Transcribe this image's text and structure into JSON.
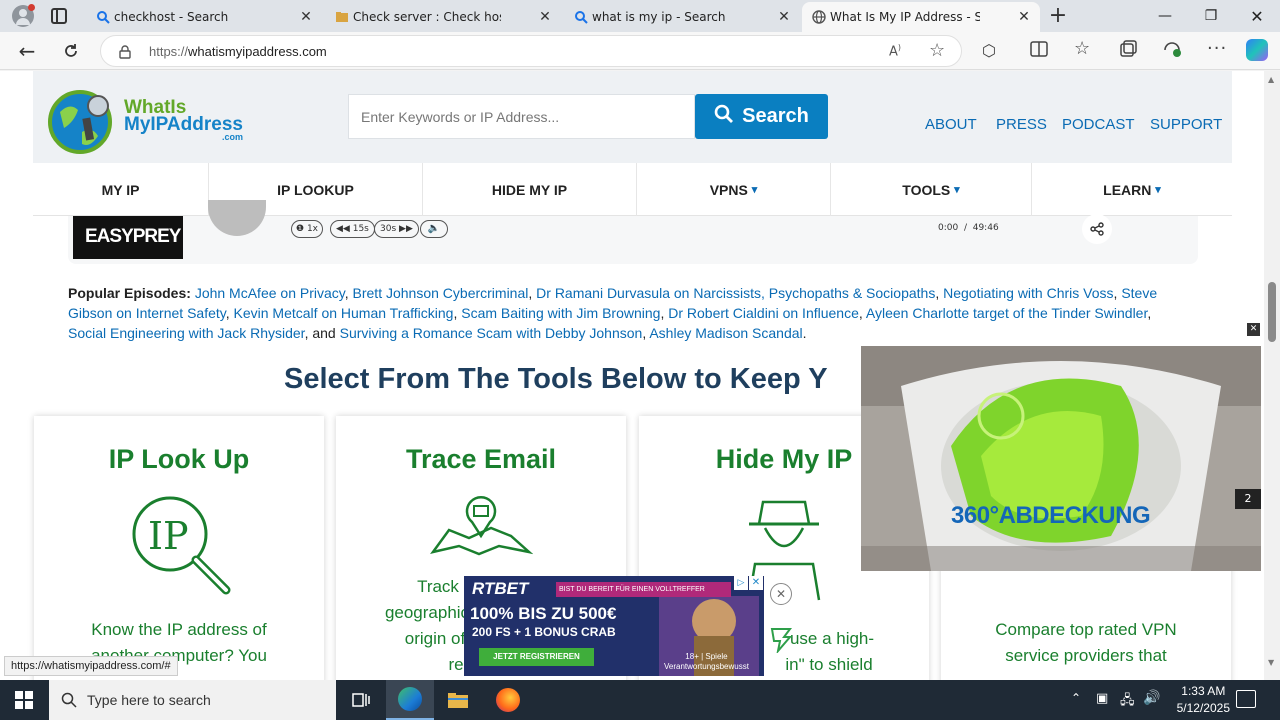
{
  "browser": {
    "tabs": [
      {
        "title": "checkhost - Search",
        "active": false
      },
      {
        "title": "Check server : Check host - online",
        "active": false
      },
      {
        "title": "what is my ip - Search",
        "active": false
      },
      {
        "title": "What Is My IP Address - See Your",
        "active": true
      }
    ],
    "url_prefix": "https://",
    "url_host": "whatismyipaddress.com",
    "status_url": "https://whatismyipaddress.com/#"
  },
  "site": {
    "logo_line1": "WhatIs",
    "logo_line2": "MyIPAddress",
    "logo_line3": ".com",
    "search_placeholder": "Enter Keywords or IP Address...",
    "search_button": "Search",
    "top_links": [
      "ABOUT",
      "PRESS",
      "PODCAST",
      "SUPPORT"
    ],
    "nav": [
      {
        "label": "MY IP",
        "arrow": ""
      },
      {
        "label": "IP LOOKUP",
        "arrow": ""
      },
      {
        "label": "HIDE MY IP",
        "arrow": ""
      },
      {
        "label": "VPNS",
        "arrow": "▾"
      },
      {
        "label": "TOOLS",
        "arrow": "▾"
      },
      {
        "label": "LEARN",
        "arrow": "▾"
      }
    ],
    "player": {
      "cover_text": "EASYPREY",
      "speed": "1x",
      "back": "15s",
      "fwd": "30s",
      "time_current": "0:00",
      "time_sep": "/",
      "time_total": "49:46"
    },
    "popular_label": "Popular Episodes:",
    "episodes": [
      "John McAfee on Privacy",
      "Brett Johnson Cybercriminal",
      "Dr Ramani Durvasula on Narcissists, Psychopaths & Sociopaths",
      "Negotiating with Chris Voss",
      "Steve Gibson on Internet Safety",
      "Kevin Metcalf on Human Trafficking",
      "Scam Baiting with Jim Browning",
      "Dr Robert Cialdini on Influence",
      "Ayleen Charlotte target of the Tinder Swindler",
      "Social Engineering with Jack Rhysider",
      "Surviving a Romance Scam with Debby Johnson",
      "Ashley Madison Scandal"
    ],
    "episodes_and": ", and ",
    "tools_heading": "Select From The Tools Below to Keep Y",
    "cards": [
      {
        "title": "IP Look Up",
        "desc1": "Know the IP address of",
        "desc2": "another computer? You"
      },
      {
        "title": "Trace Email",
        "desc1": "Track",
        "desc2": "geographic",
        "desc3": "origin of",
        "desc4": "re"
      },
      {
        "title": "Hide My IP",
        "desc1": "use a high-",
        "desc2": "in\" to shield"
      },
      {
        "title": "",
        "desc1": "Compare top rated VPN",
        "desc2": "service providers that"
      }
    ]
  },
  "ads": {
    "video_text": "360°ABDECKUNG",
    "video_counter": "2",
    "bottom": {
      "brand": "RTBET",
      "tagline": "BIST DU BEREIT FÜR EINEN VOLLTREFFER",
      "offer1": "100% BIS ZU 500€",
      "offer2": "200 FS + 1 BONUS CRAB",
      "cta": "JETZT REGISTRIEREN",
      "legal1": "18+ | Spiele",
      "legal2": "Verantwortungsbewusst"
    }
  },
  "taskbar": {
    "search_placeholder": "Type here to search",
    "time": "1:33 AM",
    "date": "5/12/2025"
  },
  "colors": {
    "brand_blue": "#0a7fc1",
    "link_blue": "#0a6bb4",
    "card_green": "#1a7f2e",
    "heading_navy": "#1f3f5e"
  }
}
